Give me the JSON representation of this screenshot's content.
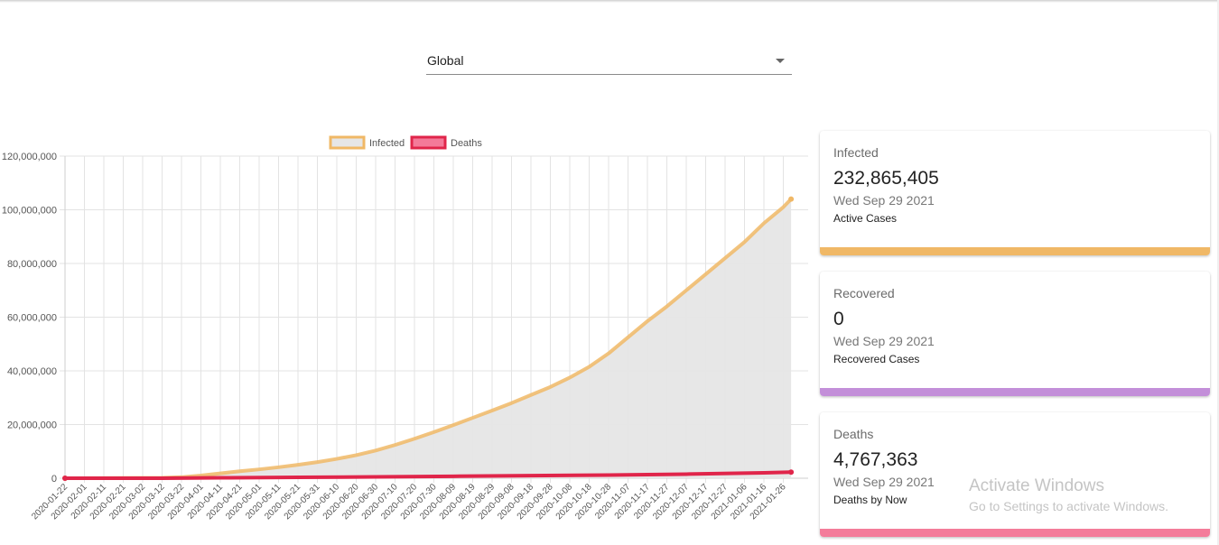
{
  "selector": {
    "value": "Global"
  },
  "chart_data": {
    "type": "area",
    "legend": [
      {
        "name": "Infected",
        "fill": "#e6e6e6",
        "stroke": "#f0b866"
      },
      {
        "name": "Deaths",
        "fill": "#f47a99",
        "stroke": "#e0254a"
      }
    ],
    "legend_position": "top",
    "grid": true,
    "ylim": [
      0,
      120000000
    ],
    "yticks": [
      "0",
      "20,000,000",
      "40,000,000",
      "60,000,000",
      "80,000,000",
      "100,000,000",
      "120,000,000"
    ],
    "xticks": [
      "2020-01-22",
      "2020-02-01",
      "2020-02-11",
      "2020-02-21",
      "2020-03-02",
      "2020-03-12",
      "2020-03-22",
      "2020-04-01",
      "2020-04-11",
      "2020-04-21",
      "2020-05-01",
      "2020-05-11",
      "2020-05-21",
      "2020-05-31",
      "2020-06-10",
      "2020-06-20",
      "2020-06-30",
      "2020-07-10",
      "2020-07-20",
      "2020-07-30",
      "2020-08-09",
      "2020-08-19",
      "2020-08-29",
      "2020-09-08",
      "2020-09-18",
      "2020-09-28",
      "2020-10-08",
      "2020-10-18",
      "2020-10-28",
      "2020-11-07",
      "2020-11-17",
      "2020-11-27",
      "2020-12-07",
      "2020-12-17",
      "2020-12-27",
      "2021-01-06",
      "2021-01-16",
      "2021-01-26"
    ],
    "series": [
      {
        "name": "Infected",
        "x": [
          "2020-01-22",
          "2020-03-12",
          "2020-03-22",
          "2020-04-01",
          "2020-04-11",
          "2020-04-21",
          "2020-05-01",
          "2020-05-11",
          "2020-05-21",
          "2020-05-31",
          "2020-06-10",
          "2020-06-20",
          "2020-06-30",
          "2020-07-10",
          "2020-07-20",
          "2020-07-30",
          "2020-08-09",
          "2020-08-19",
          "2020-08-29",
          "2020-09-08",
          "2020-09-18",
          "2020-09-28",
          "2020-10-08",
          "2020-10-18",
          "2020-10-28",
          "2020-11-07",
          "2020-11-17",
          "2020-11-27",
          "2020-12-07",
          "2020-12-17",
          "2020-12-27",
          "2021-01-06",
          "2021-01-16",
          "2021-01-26",
          "2021-01-30"
        ],
        "values": [
          0,
          150000,
          400000,
          1000000,
          1800000,
          2600000,
          3300000,
          4100000,
          5000000,
          6000000,
          7200000,
          8600000,
          10300000,
          12400000,
          14700000,
          17200000,
          19800000,
          22500000,
          25200000,
          28000000,
          31000000,
          34000000,
          37500000,
          41500000,
          46500000,
          52500000,
          58500000,
          64000000,
          70000000,
          76000000,
          82000000,
          88000000,
          95000000,
          101000000,
          104000000
        ]
      },
      {
        "name": "Deaths",
        "x": [
          "2020-01-22",
          "2020-03-12",
          "2020-04-11",
          "2020-05-21",
          "2020-06-30",
          "2020-08-09",
          "2020-09-18",
          "2020-10-28",
          "2020-12-07",
          "2021-01-16",
          "2021-01-30"
        ],
        "values": [
          0,
          5000,
          150000,
          330000,
          500000,
          730000,
          960000,
          1180000,
          1530000,
          2020000,
          2250000
        ]
      }
    ]
  },
  "cards": [
    {
      "title": "Infected",
      "value": "232,865,405",
      "date": "Wed Sep 29 2021",
      "desc": "Active Cases",
      "color": "#f0b866"
    },
    {
      "title": "Recovered",
      "value": "0",
      "date": "Wed Sep 29 2021",
      "desc": "Recovered Cases",
      "color": "#c38fd9"
    },
    {
      "title": "Deaths",
      "value": "4,767,363",
      "date": "Wed Sep 29 2021",
      "desc": "Deaths by Now",
      "color": "#f47c9a"
    }
  ],
  "watermark": {
    "line1": "Activate Windows",
    "line2": "Go to Settings to activate Windows."
  }
}
